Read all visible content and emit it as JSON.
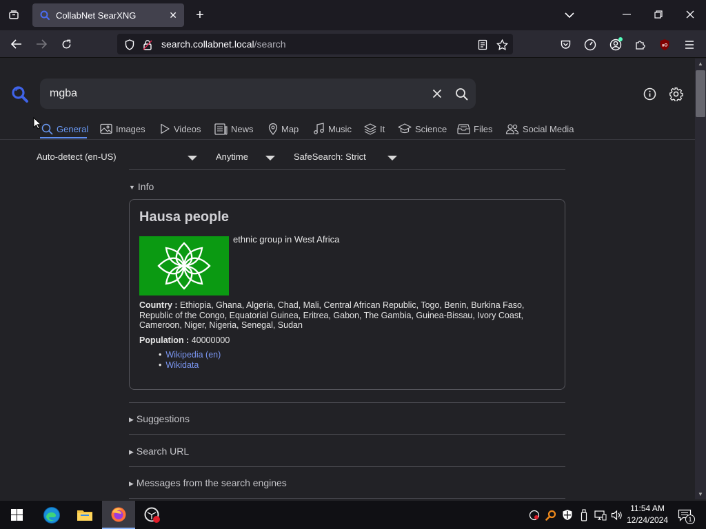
{
  "browser": {
    "tab_title": "CollabNet SearXNG",
    "url_host": "search.collabnet.local",
    "url_path": "/search"
  },
  "search": {
    "query": "mgba"
  },
  "categories": [
    {
      "label": "General",
      "icon": "search-icon"
    },
    {
      "label": "Images",
      "icon": "image-icon"
    },
    {
      "label": "Videos",
      "icon": "play-icon"
    },
    {
      "label": "News",
      "icon": "newspaper-icon"
    },
    {
      "label": "Map",
      "icon": "map-pin-icon"
    },
    {
      "label": "Music",
      "icon": "music-icon"
    },
    {
      "label": "It",
      "icon": "layers-icon"
    },
    {
      "label": "Science",
      "icon": "school-icon"
    },
    {
      "label": "Files",
      "icon": "file-tray-icon"
    },
    {
      "label": "Social Media",
      "icon": "people-icon"
    }
  ],
  "filters": {
    "language": "Auto-detect (en-US)",
    "time": "Anytime",
    "safesearch": "SafeSearch: Strict"
  },
  "sections": {
    "info": "Info",
    "suggestions": "Suggestions",
    "search_url": "Search URL",
    "messages": "Messages from the search engines"
  },
  "infobox": {
    "title": "Hausa people",
    "description": "ethnic group in West Africa",
    "country_label": "Country :",
    "country_value": "Ethiopia, Ghana, Algeria, Chad, Mali, Central African Republic, Togo, Benin, Burkina Faso, Republic of the Congo, Equatorial Guinea, Eritrea, Gabon, The Gambia, Guinea-Bissau, Ivory Coast, Cameroon, Niger, Nigeria, Senegal, Sudan",
    "population_label": "Population :",
    "population_value": "40000000",
    "links": [
      "Wikipedia (en)",
      "Wikidata"
    ]
  },
  "taskbar": {
    "time": "11:54 AM",
    "date": "12/24/2024",
    "notification_count": "1"
  },
  "colors": {
    "accent": "#5f8ef0",
    "page_bg": "#222226",
    "flag_green": "#0b9a12"
  }
}
